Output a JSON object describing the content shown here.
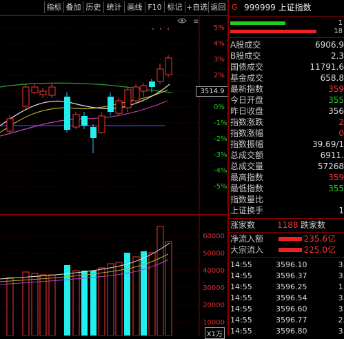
{
  "toolbar": {
    "items": [
      "指标",
      "叠加",
      "历史",
      "统计",
      "画线",
      "F10",
      "标记",
      "+自选",
      "返回"
    ]
  },
  "main_axis": {
    "pct_labels": [
      "5%",
      "4%",
      "3%",
      "2%",
      "1%",
      "0%",
      "-1%",
      "-2%",
      "-3%",
      "-4%",
      "-5%"
    ],
    "price_tag": "3514.9"
  },
  "volume_axis": {
    "labels": [
      "60000",
      "50000",
      "40000",
      "30000",
      "20000",
      "10000"
    ],
    "unit": "X1万"
  },
  "panel": {
    "title_prefix": "G",
    "title": "999999 上证指数",
    "bar_values": [
      "1",
      "18"
    ],
    "stats": [
      {
        "label": "A股成交",
        "value": "6906.9",
        "color": "#dddddd"
      },
      {
        "label": "B股成交",
        "value": "2.3",
        "color": "#dddddd"
      },
      {
        "label": "国债成交",
        "value": "11791.6",
        "color": "#dddddd"
      },
      {
        "label": "基金成交",
        "value": "658.8",
        "color": "#dddddd"
      },
      {
        "label": "最新指数",
        "value": "359",
        "color": "#ff3333"
      },
      {
        "label": "今日开盘",
        "value": "355",
        "color": "#22cc22"
      },
      {
        "label": "昨日收盘",
        "value": "356",
        "color": "#dddddd"
      },
      {
        "label": "指数涨跌",
        "value": "2",
        "color": "#ff3333"
      },
      {
        "label": "指数涨幅",
        "value": "0",
        "color": "#ff3333"
      },
      {
        "label": "指数振幅",
        "value": "39.69/1",
        "color": "#dddddd"
      },
      {
        "label": "总成交额",
        "value": "6911.",
        "color": "#dddddd"
      },
      {
        "label": "总成交量",
        "value": "57268",
        "color": "#dddddd"
      },
      {
        "label": "最高指数",
        "value": "359",
        "color": "#ff3333"
      },
      {
        "label": "最低指数",
        "value": "355",
        "color": "#22cc22"
      },
      {
        "label": "指数量比",
        "value": "",
        "color": "#dddddd"
      },
      {
        "label": "上证换手",
        "value": "1",
        "color": "#dddddd"
      }
    ],
    "updown": {
      "up_label": "涨家数",
      "up_value": "1188",
      "down_label": "跌家数",
      "down_value": ""
    },
    "flows": [
      {
        "label": "净流入额",
        "value": "235.6亿"
      },
      {
        "label": "大宗流入",
        "value": "225.0亿"
      }
    ],
    "ticks": [
      {
        "time": "14:55",
        "price": "3596.10",
        "vol": "3."
      },
      {
        "time": "14:55",
        "price": "3596.37",
        "vol": "3."
      },
      {
        "time": "14:55",
        "price": "3596.25",
        "vol": "1."
      },
      {
        "time": "14:55",
        "price": "3596.54",
        "vol": "3."
      },
      {
        "time": "14:55",
        "price": "3596.60",
        "vol": "3."
      },
      {
        "time": "14:55",
        "price": "3596.77",
        "vol": "2."
      },
      {
        "time": "14:55",
        "price": "3596.80",
        "vol": "3."
      }
    ]
  }
}
